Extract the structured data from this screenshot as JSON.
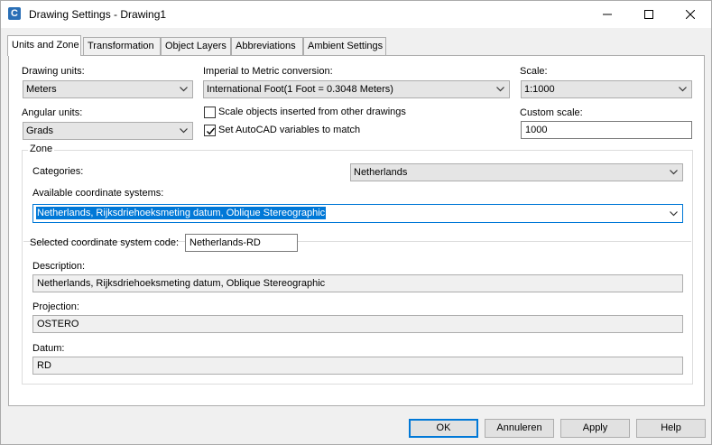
{
  "window": {
    "title": "Drawing Settings - Drawing1",
    "app_icon_letter": "C"
  },
  "tabs": [
    {
      "label": "Units and Zone"
    },
    {
      "label": "Transformation"
    },
    {
      "label": "Object Layers"
    },
    {
      "label": "Abbreviations"
    },
    {
      "label": "Ambient Settings"
    }
  ],
  "units": {
    "drawing_units_label": "Drawing units:",
    "drawing_units_value": "Meters",
    "conversion_label": "Imperial to Metric conversion:",
    "conversion_value": "International Foot(1 Foot = 0.3048 Meters)",
    "scale_label": "Scale:",
    "scale_value": "1:1000",
    "angular_units_label": "Angular units:",
    "angular_units_value": "Grads",
    "scale_objects_label": "Scale objects inserted from other drawings",
    "scale_objects_checked": false,
    "set_autocad_label": "Set AutoCAD variables to match",
    "set_autocad_checked": true,
    "custom_scale_label": "Custom scale:",
    "custom_scale_value": "1000"
  },
  "zone": {
    "group_title": "Zone",
    "categories_label": "Categories:",
    "categories_value": "Netherlands",
    "available_label": "Available coordinate systems:",
    "available_value": "Netherlands, Rijksdriehoeksmeting datum, Oblique Stereographic",
    "code_label": "Selected coordinate system code:",
    "code_value": "Netherlands-RD",
    "description_label": "Description:",
    "description_value": "Netherlands, Rijksdriehoeksmeting datum, Oblique Stereographic",
    "projection_label": "Projection:",
    "projection_value": "OSTERO",
    "datum_label": "Datum:",
    "datum_value": "RD"
  },
  "buttons": {
    "ok": "OK",
    "cancel": "Annuleren",
    "apply": "Apply",
    "help": "Help"
  }
}
